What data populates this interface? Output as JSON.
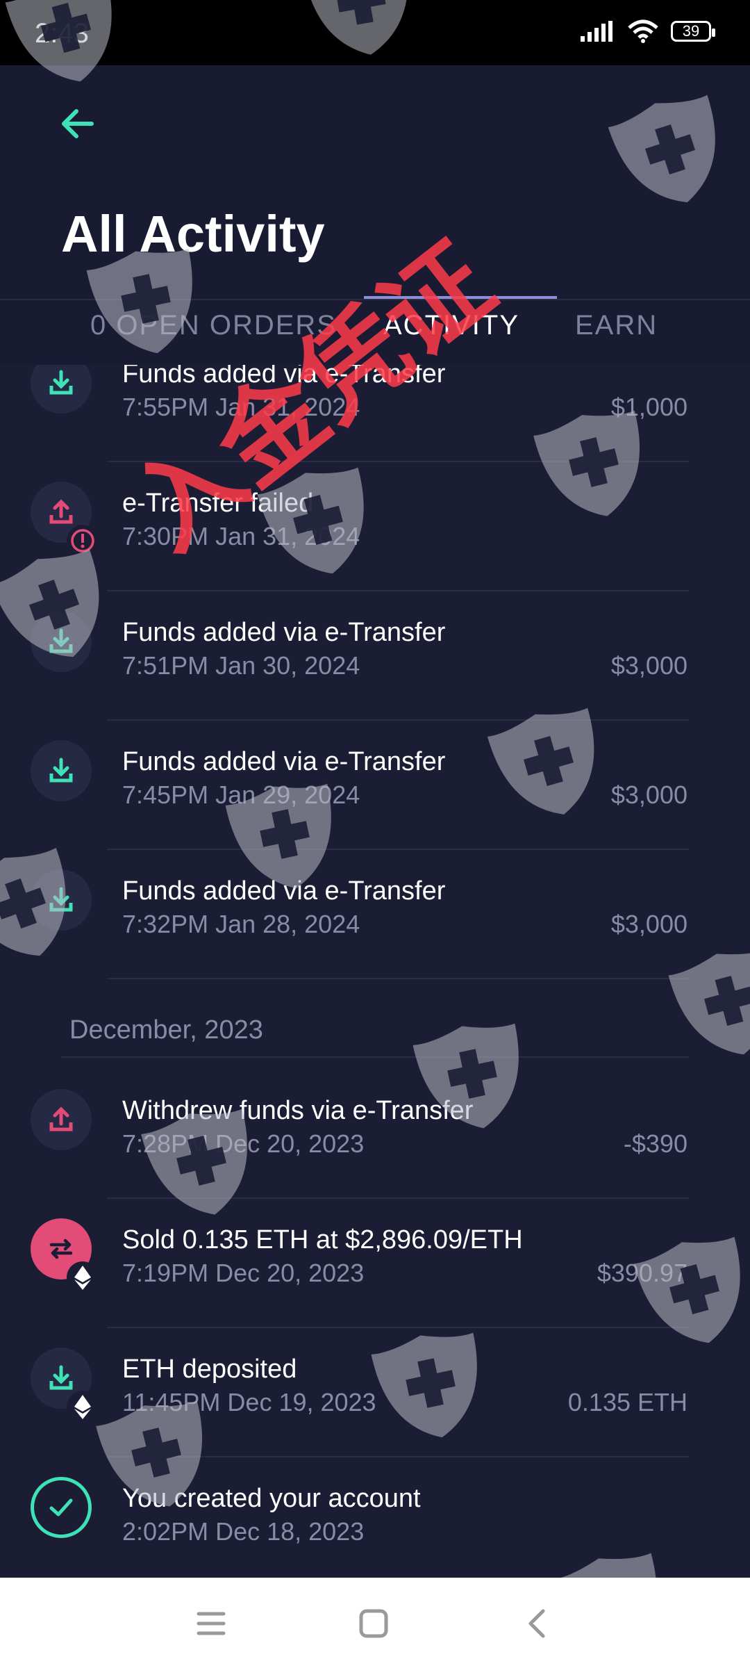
{
  "status": {
    "time": "2:43",
    "battery": "39"
  },
  "header": {
    "title": "All Activity",
    "tabs": [
      {
        "label": "0 OPEN ORDERS",
        "active": false
      },
      {
        "label": "ACTIVITY",
        "active": true
      },
      {
        "label": "EARN",
        "active": false
      }
    ]
  },
  "activity": {
    "rows": [
      {
        "title": "Funds added via e-Transfer",
        "time": "7:55PM Jan 31, 2024",
        "amount": "$1,000",
        "icon": "download-icon"
      },
      {
        "title": "e-Transfer failed",
        "time": "7:30PM Jan 31, 2024",
        "amount": "",
        "icon": "upload-icon",
        "badge": "alert-icon"
      },
      {
        "title": "Funds added via e-Transfer",
        "time": "7:51PM Jan 30, 2024",
        "amount": "$3,000",
        "icon": "download-icon"
      },
      {
        "title": "Funds added via e-Transfer",
        "time": "7:45PM Jan 29, 2024",
        "amount": "$3,000",
        "icon": "download-icon"
      },
      {
        "title": "Funds added via e-Transfer",
        "time": "7:32PM Jan 28, 2024",
        "amount": "$3,000",
        "icon": "download-icon"
      }
    ],
    "section_december": "December, 2023",
    "rows_dec": [
      {
        "title": "Withdrew funds via e-Transfer",
        "time": "7:28PM Dec 20, 2023",
        "amount": "-$390",
        "icon": "upload-icon"
      },
      {
        "title": "Sold 0.135 ETH at $2,896.09/ETH",
        "time": "7:19PM Dec 20, 2023",
        "amount": "$390.97",
        "icon": "swap-icon",
        "badge": "ethereum-icon"
      },
      {
        "title": "ETH deposited",
        "time": "11:45PM Dec 19, 2023",
        "amount": "0.135 ETH",
        "icon": "download-icon",
        "badge": "ethereum-icon"
      },
      {
        "title": "You created your account",
        "time": "2:02PM Dec 18, 2023",
        "amount": "",
        "icon": "check-icon"
      }
    ]
  },
  "overlay": {
    "stamp_text": "入金凭证"
  },
  "colors": {
    "background": "#1b1d34",
    "accent_teal": "#3fe2b7",
    "accent_pink": "#e24c77",
    "muted_text": "#8a8ca6"
  }
}
